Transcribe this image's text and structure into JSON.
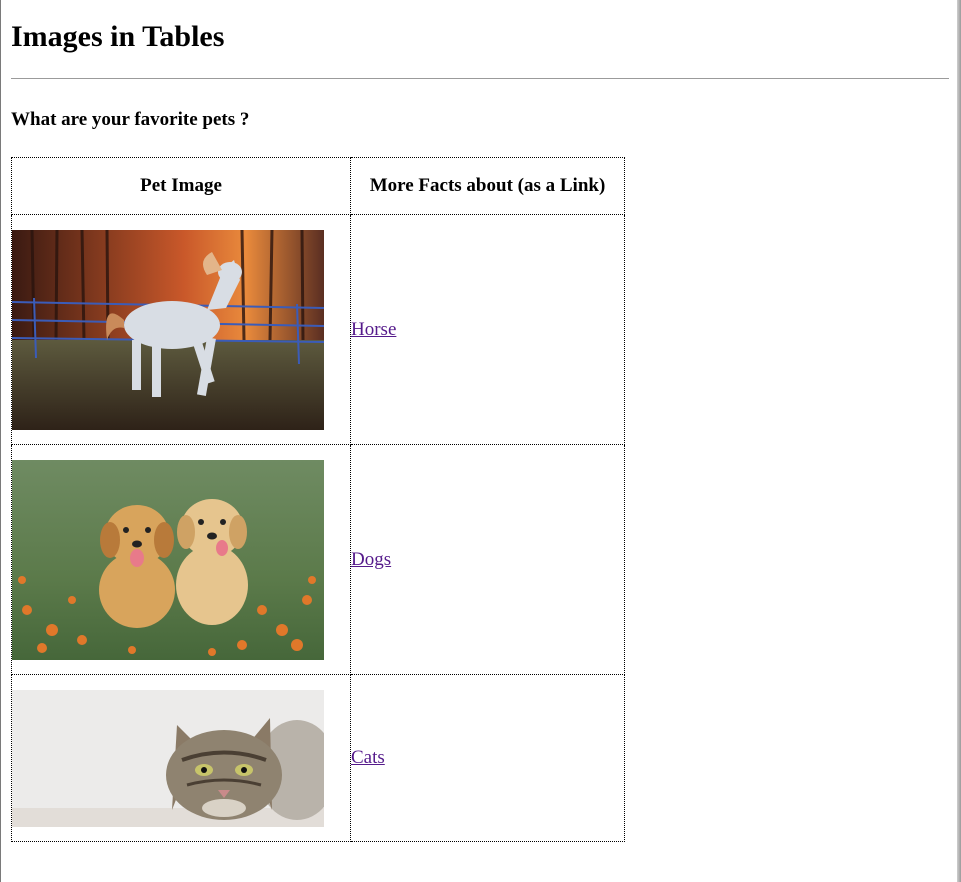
{
  "page": {
    "title": "Images in Tables",
    "question": "What are your favorite pets ?"
  },
  "table": {
    "headers": [
      "Pet Image",
      "More Facts about (as a Link)"
    ],
    "rows": [
      {
        "image": "horse-photo",
        "link_text": "Horse"
      },
      {
        "image": "dogs-photo",
        "link_text": "Dogs"
      },
      {
        "image": "cat-photo",
        "link_text": "Cats"
      }
    ]
  },
  "colors": {
    "visited_link": "#551a8b",
    "text": "#000000",
    "divider": "#9b9b9b"
  }
}
